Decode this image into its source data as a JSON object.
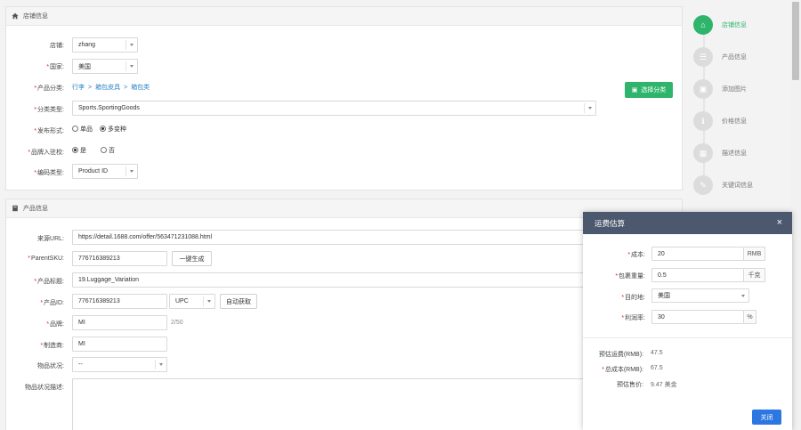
{
  "store_panel": {
    "title": "店铺信息",
    "fields": {
      "store_label": "店铺:",
      "store_value": "zhang",
      "country_label": "国家:",
      "country_value": "美国",
      "category_label": "产品分类:",
      "category_path": [
        "行李",
        "箱包皮具",
        "箱包类"
      ],
      "category_sep": ">",
      "category_button": "选择分类",
      "type_label": "分类类型:",
      "type_value": "Sports.SportingGoods",
      "mode_label": "发布形式:",
      "mode_opt1": "单品",
      "mode_opt2": "多变种",
      "brand_label": "品牌入驻校:",
      "brand_opt1": "是",
      "brand_opt2": "否",
      "code_label": "编码类型:",
      "code_value": "Product ID"
    }
  },
  "product_panel": {
    "title": "产品信息",
    "fields": {
      "url_label": "来源URL:",
      "url_value": "https://detail.1688.com/offer/563471231088.html",
      "sku_label": "ParentSKU:",
      "sku_value": "776716389213",
      "sku_button": "一键生成",
      "title_label": "产品标题:",
      "title_value": "19.Luggage_Variation",
      "pid_label": "产品ID:",
      "pid_value": "776716389213",
      "pid_type": "UPC",
      "pid_button": "自动获取",
      "brand_label": "品牌:",
      "brand_value": "MI",
      "brand_count": "2/50",
      "maker_label": "制造商:",
      "maker_value": "MI",
      "condition_label": "物品状况:",
      "condition_value": "--",
      "condition_desc_label": "物品状况描述:"
    }
  },
  "steps": [
    {
      "label": "店铺信息",
      "icon": "home-icon",
      "glyph": "⌂",
      "active": true
    },
    {
      "label": "产品信息",
      "icon": "list-icon",
      "glyph": "☰",
      "active": false
    },
    {
      "label": "添加图片",
      "icon": "image-icon",
      "glyph": "▣",
      "active": false
    },
    {
      "label": "价格信息",
      "icon": "info-icon",
      "glyph": "ℹ",
      "active": false
    },
    {
      "label": "描述信息",
      "icon": "grid-icon",
      "glyph": "▦",
      "active": false
    },
    {
      "label": "关键词信息",
      "icon": "tag-icon",
      "glyph": "✎",
      "active": false
    }
  ],
  "modal": {
    "title": "运费估算",
    "close": "×",
    "cost_label": "成本:",
    "cost_value": "20",
    "cost_unit": "RMB",
    "weight_label": "包裹重量:",
    "weight_value": "0.5",
    "weight_unit": "千克",
    "dest_label": "目的地:",
    "dest_value": "美国",
    "profit_label": "利润率:",
    "profit_value": "30",
    "profit_unit": "%",
    "freight_label": "预估运费(RMB):",
    "freight_value": "47.5",
    "total_label": "总成本(RMB):",
    "total_value": "67.5",
    "price_label": "预估售价:",
    "price_value": "9.47 美金",
    "close_button": "关闭"
  },
  "colors": {
    "accent_green": "#2fb56b",
    "modal_header": "#4c586e",
    "primary_blue": "#2c77e1",
    "link_blue": "#2a83c7",
    "required_red": "#e2231a"
  }
}
